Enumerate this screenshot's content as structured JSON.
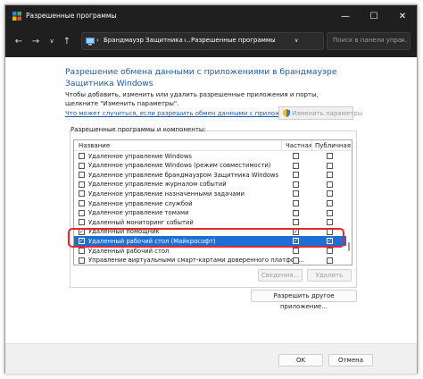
{
  "window": {
    "title": "Разрешенные программы"
  },
  "nav": {
    "breadcrumb_1": "Брандмауэр Защитника ...",
    "breadcrumb_2": "Разрешенные программы",
    "search_placeholder": "Поиск в панели упра..."
  },
  "main": {
    "heading": "Разрешение обмена данными с приложениями в брандмауэре Защитника Windows",
    "description": "Чтобы добавить, изменить или удалить разрешенные приложения и порты, щелкните \"Изменить параметры\".",
    "risk_link": "Что может случиться, если разрешить обмен данными с приложением?",
    "change_settings": "Изменить параметры",
    "group_label": "Разрешенные программы и компоненты:",
    "columns": {
      "name": "Название",
      "private": "Частная",
      "public": "Публичная"
    },
    "rows": [
      {
        "name": "Удаленное управление Windows",
        "enabled": false,
        "private": false,
        "public": false,
        "selected": false
      },
      {
        "name": "Удаленное управление Windows (режим совместимости)",
        "enabled": false,
        "private": false,
        "public": false,
        "selected": false
      },
      {
        "name": "Удаленное управление брандмауэром Защитника Windows",
        "enabled": false,
        "private": false,
        "public": false,
        "selected": false
      },
      {
        "name": "Удаленное управление журналом событий",
        "enabled": false,
        "private": false,
        "public": false,
        "selected": false
      },
      {
        "name": "Удаленное управление назначенными задачами",
        "enabled": false,
        "private": false,
        "public": false,
        "selected": false
      },
      {
        "name": "Удаленное управление службой",
        "enabled": false,
        "private": false,
        "public": false,
        "selected": false
      },
      {
        "name": "Удаленное управление томами",
        "enabled": false,
        "private": false,
        "public": false,
        "selected": false
      },
      {
        "name": "Удаленный мониторинг событий",
        "enabled": false,
        "private": false,
        "public": false,
        "selected": false
      },
      {
        "name": "Удаленный помощник",
        "enabled": true,
        "private": true,
        "public": false,
        "selected": false
      },
      {
        "name": "Удаленный рабочий стол (Майкрософт)",
        "enabled": true,
        "private": true,
        "public": true,
        "selected": true
      },
      {
        "name": "Удаленный рабочий стол",
        "enabled": false,
        "private": false,
        "public": false,
        "selected": false
      },
      {
        "name": "Управление виртуальными смарт-картами доверенного платфор...",
        "enabled": false,
        "private": false,
        "public": false,
        "selected": false
      }
    ],
    "details_button": "Сведения...",
    "delete_button": "Удалить",
    "allow_other_button": "Разрешить другое приложение..."
  },
  "footer": {
    "ok": "OK",
    "cancel": "Отмена"
  },
  "colors": {
    "titlebar": "#1f1f1f",
    "heading": "#1e5aa8",
    "selection": "#1c6fd6",
    "highlight": "#e0282e"
  }
}
